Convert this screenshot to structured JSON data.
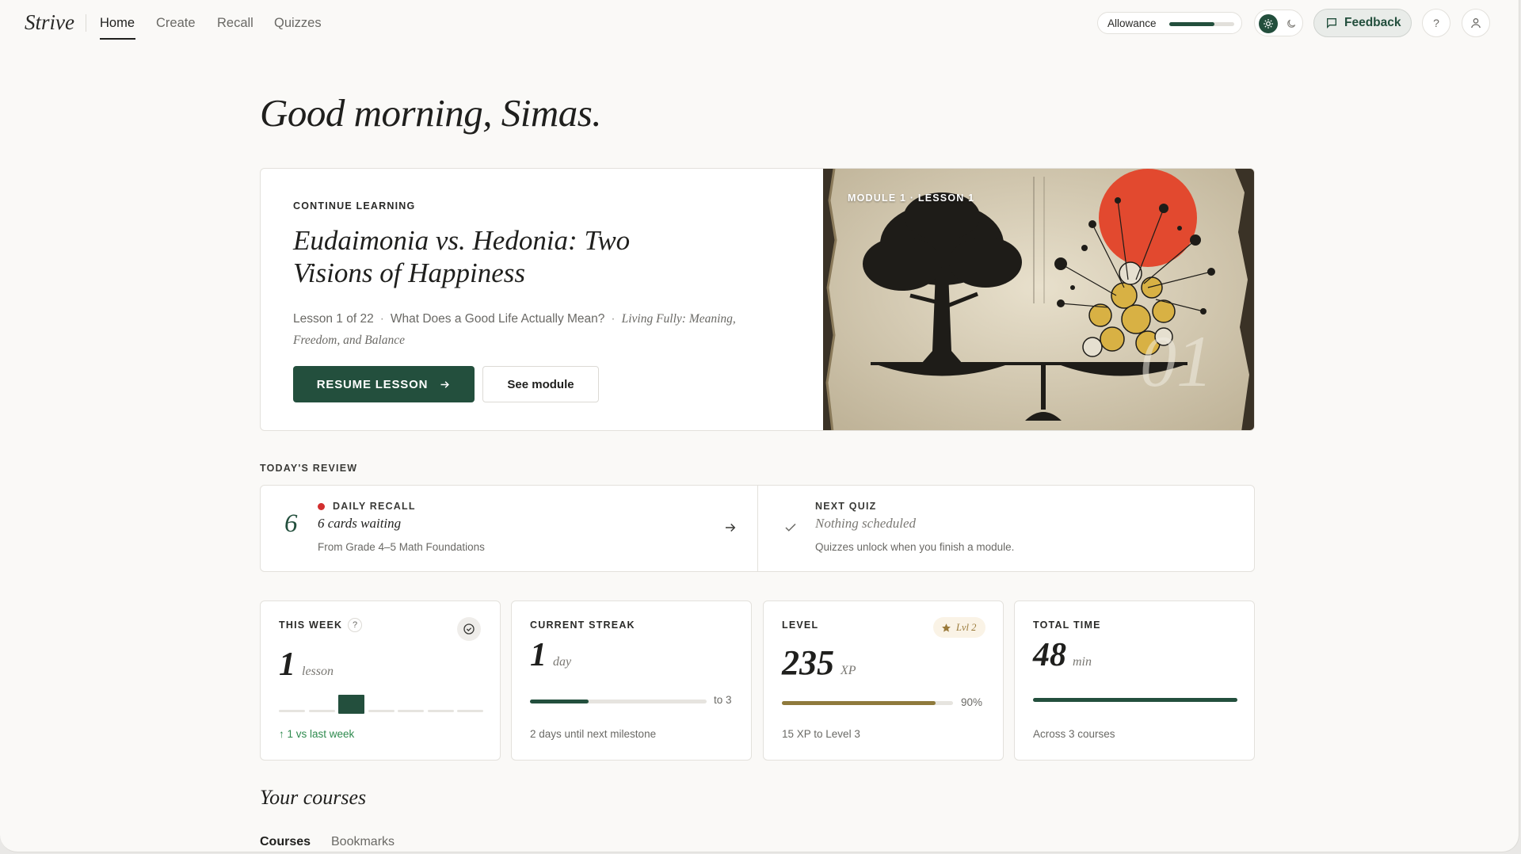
{
  "nav": {
    "brand": "Strive",
    "items": [
      {
        "label": "Home",
        "active": true
      },
      {
        "label": "Create"
      },
      {
        "label": "Recall"
      },
      {
        "label": "Quizzes"
      }
    ],
    "allowance_label": "Allowance",
    "allowance_fraction": 0.7,
    "feedback_label": "Feedback",
    "help_label": "?"
  },
  "greeting": "Good morning, Simas.",
  "continue": {
    "eyebrow": "CONTINUE LEARNING",
    "title": "Eudaimonia vs. Hedonia: Two Visions of Happiness",
    "lesson": "Lesson 1 of 22",
    "module": "What Does a Good Life Actually Mean?",
    "course": "Living Fully: Meaning, Freedom, and Balance",
    "resume_label": "RESUME LESSON",
    "see_module_label": "See module",
    "art_label": "MODULE 1 · LESSON 1",
    "art_number": "01"
  },
  "review": {
    "section_label": "TODAY'S REVIEW",
    "recall": {
      "count": "6",
      "eyebrow": "DAILY RECALL",
      "title": "6 cards waiting",
      "sub": "From Grade 4–5 Math Foundations"
    },
    "quiz": {
      "eyebrow": "NEXT QUIZ",
      "title": "Nothing scheduled",
      "sub": "Quizzes unlock when you finish a module."
    }
  },
  "stats": {
    "week": {
      "eyebrow": "THIS WEEK",
      "value": "1",
      "unit": "lesson",
      "delta": "1 vs last week",
      "help": "?",
      "bars": [
        0,
        0,
        1,
        0,
        0,
        0,
        0
      ]
    },
    "streak": {
      "eyebrow": "CURRENT STREAK",
      "value": "1",
      "unit": "day",
      "progress": 0.33,
      "target": "to 3",
      "foot": "2 days until next milestone"
    },
    "level": {
      "eyebrow": "LEVEL",
      "value": "235",
      "unit": "XP",
      "badge": "Lvl 2",
      "progress": 0.9,
      "percent": "90%",
      "foot": "15 XP to Level 3"
    },
    "time": {
      "eyebrow": "TOTAL TIME",
      "value": "48",
      "unit": "min",
      "progress": 1.0,
      "foot": "Across 3 courses"
    }
  },
  "courses": {
    "title": "Your courses",
    "tabs": [
      {
        "label": "Courses",
        "active": true
      },
      {
        "label": "Bookmarks"
      }
    ]
  },
  "colors": {
    "accent": "#234f3d",
    "gold": "#8f7a3c",
    "alert": "#d22f2f",
    "positive": "#2e8a4e"
  }
}
